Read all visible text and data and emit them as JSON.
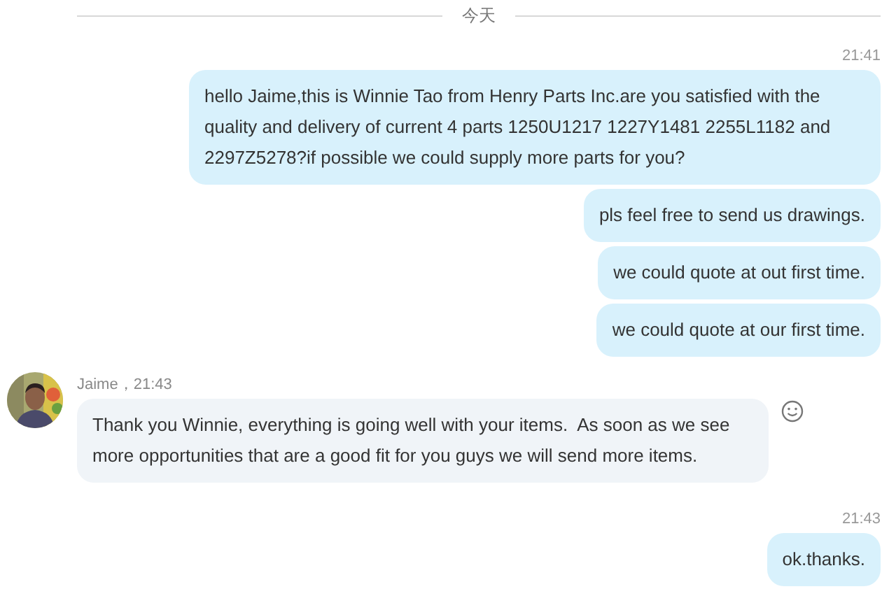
{
  "date_divider": "今天",
  "groups": [
    {
      "kind": "outgoing",
      "time": "21:41",
      "messages": [
        "hello Jaime,this is Winnie Tao from Henry Parts Inc.are you satisfied with the quality and delivery of current 4 parts 1250U1217 1227Y1481 2255L1182 and 2297Z5278?if possible we could supply more parts for you?",
        "pls feel free to send us drawings.",
        "we could quote at out first time.",
        "we could quote at our first time."
      ]
    },
    {
      "kind": "incoming",
      "sender": "Jaime，21:43",
      "messages": [
        "Thank you Winnie, everything is going well with your items.  As soon as we see more opportunities that are a good fit for you guys we will send more items."
      ]
    },
    {
      "kind": "outgoing",
      "time": "21:43",
      "messages": [
        "ok.thanks."
      ]
    }
  ]
}
